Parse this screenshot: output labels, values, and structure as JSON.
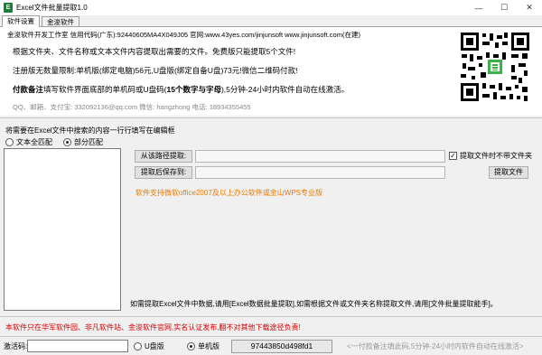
{
  "window": {
    "title": "Excel文件批量提取1.0",
    "min": "—",
    "max": "☐",
    "close": "✕"
  },
  "tabs": [
    {
      "label": "软件设置"
    },
    {
      "label": "金浚软件"
    }
  ],
  "info": {
    "line1": "金浚软件开发工作室  信用代码(广东):92440605MA4X049J05 官网:www.43yes.com/jinjunsoft  www.jinjunsoft.com(在建)",
    "line2": "根据文件夹、文件名称或文本文件内容提取出需要的文件。免费版只能提取5个文件!",
    "line3": "注册版无数量限制:单机版(绑定电脑)56元,U盘版(绑定自备U盘)73元!微信二维码付款!",
    "line4_bold": "付款备注",
    "line4_mid": "填写软件界面底部的单机码或U盘码(",
    "line4_bold2": "15个数字与字母",
    "line4_end": "),5分钟-24小时内软件自动在线激活。",
    "line5": "QQ、邮箱、支付宝: 332092136@qq.com   微信: hangzhong   电话: 18934355455"
  },
  "editor": {
    "label": "将需要在Excel文件中搜索的内容一行行填写在编辑框",
    "radio_full": "文本全匹配",
    "radio_partial": "部分匹配",
    "selected": "部分匹配"
  },
  "paths": {
    "from_button": "从该路径提取:",
    "save_button": "提取后保存到:",
    "no_folder_label": "提取文件时不带文件夹",
    "no_folder_checked": true,
    "extract_button": "提取文件"
  },
  "support": "软件支持微软office2007及以上办公软件或金山WPS专业版",
  "note": "如需提取Excel文件中数据,请用[Excel数据批量提取],如需根据文件或文件夹名称提取文件,请用[文件批量提取能手]。",
  "warning": "本软件只在华军软件园、非凡软件站、金浚软件官网,实名认证发布,翻不对其他下载途径负责!",
  "activation": {
    "label": "激活码:",
    "radio_usb": "U盘版",
    "radio_pc": "单机版",
    "selected": "单机版",
    "machine_code": "97443850d498fd1",
    "marquee": "<一付款备注填此码,5分钟-24小时内软件自动在线激活>"
  },
  "colors": {
    "warning": "#d40000",
    "support": "#e87a00"
  }
}
